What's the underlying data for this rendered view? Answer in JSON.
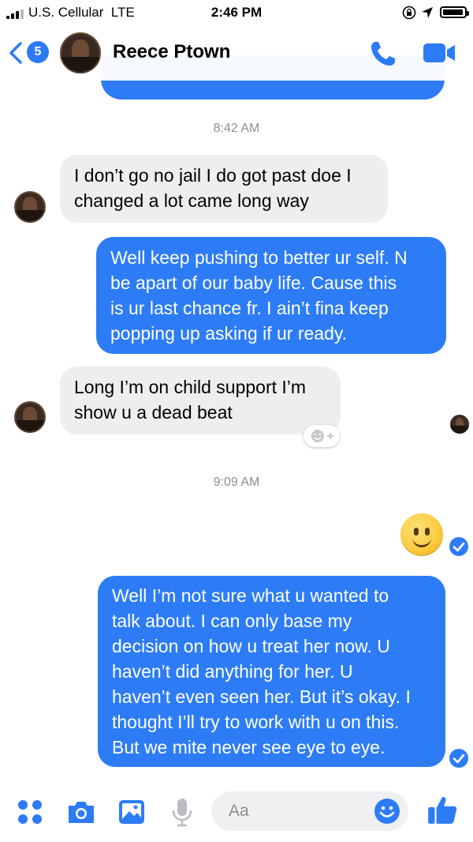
{
  "status_bar": {
    "carrier": "U.S. Cellular",
    "network": "LTE",
    "time": "2:46 PM"
  },
  "header": {
    "back_badge": "5",
    "contact_name": "Reece Ptown"
  },
  "timestamps": [
    "8:42 AM",
    "9:09 AM"
  ],
  "messages": {
    "in_1": [
      "I don’t go no jail I do got past doe I",
      "changed a lot came long way"
    ],
    "out_1": [
      "Well keep pushing to better ur self. N",
      "be apart of our baby life. Cause this",
      "is ur last chance fr. I ain’t fina keep",
      "popping up asking if ur ready."
    ],
    "in_2": [
      "Long I’m on child support I’m",
      "show u a dead beat"
    ],
    "out_2": [
      "Well I’m not sure what u wanted to",
      "talk about. I can only base my",
      "decision on how u treat her now. U",
      "haven’t did anything for her. U",
      "haven’t even seen her. But it’s okay. I",
      "thought I’ll try to work with u on this.",
      "But we mite never see eye to eye."
    ]
  },
  "composer": {
    "placeholder": "Aa"
  },
  "colors": {
    "accent": "#2d7cf6",
    "incoming_bubble": "#eeeeef",
    "timestamp_text": "#8e8e93"
  },
  "icons": [
    "apps-icon",
    "camera-icon",
    "gallery-icon",
    "mic-icon",
    "emoji-icon",
    "like-icon",
    "phone-icon",
    "video-icon",
    "back-chevron-icon"
  ]
}
